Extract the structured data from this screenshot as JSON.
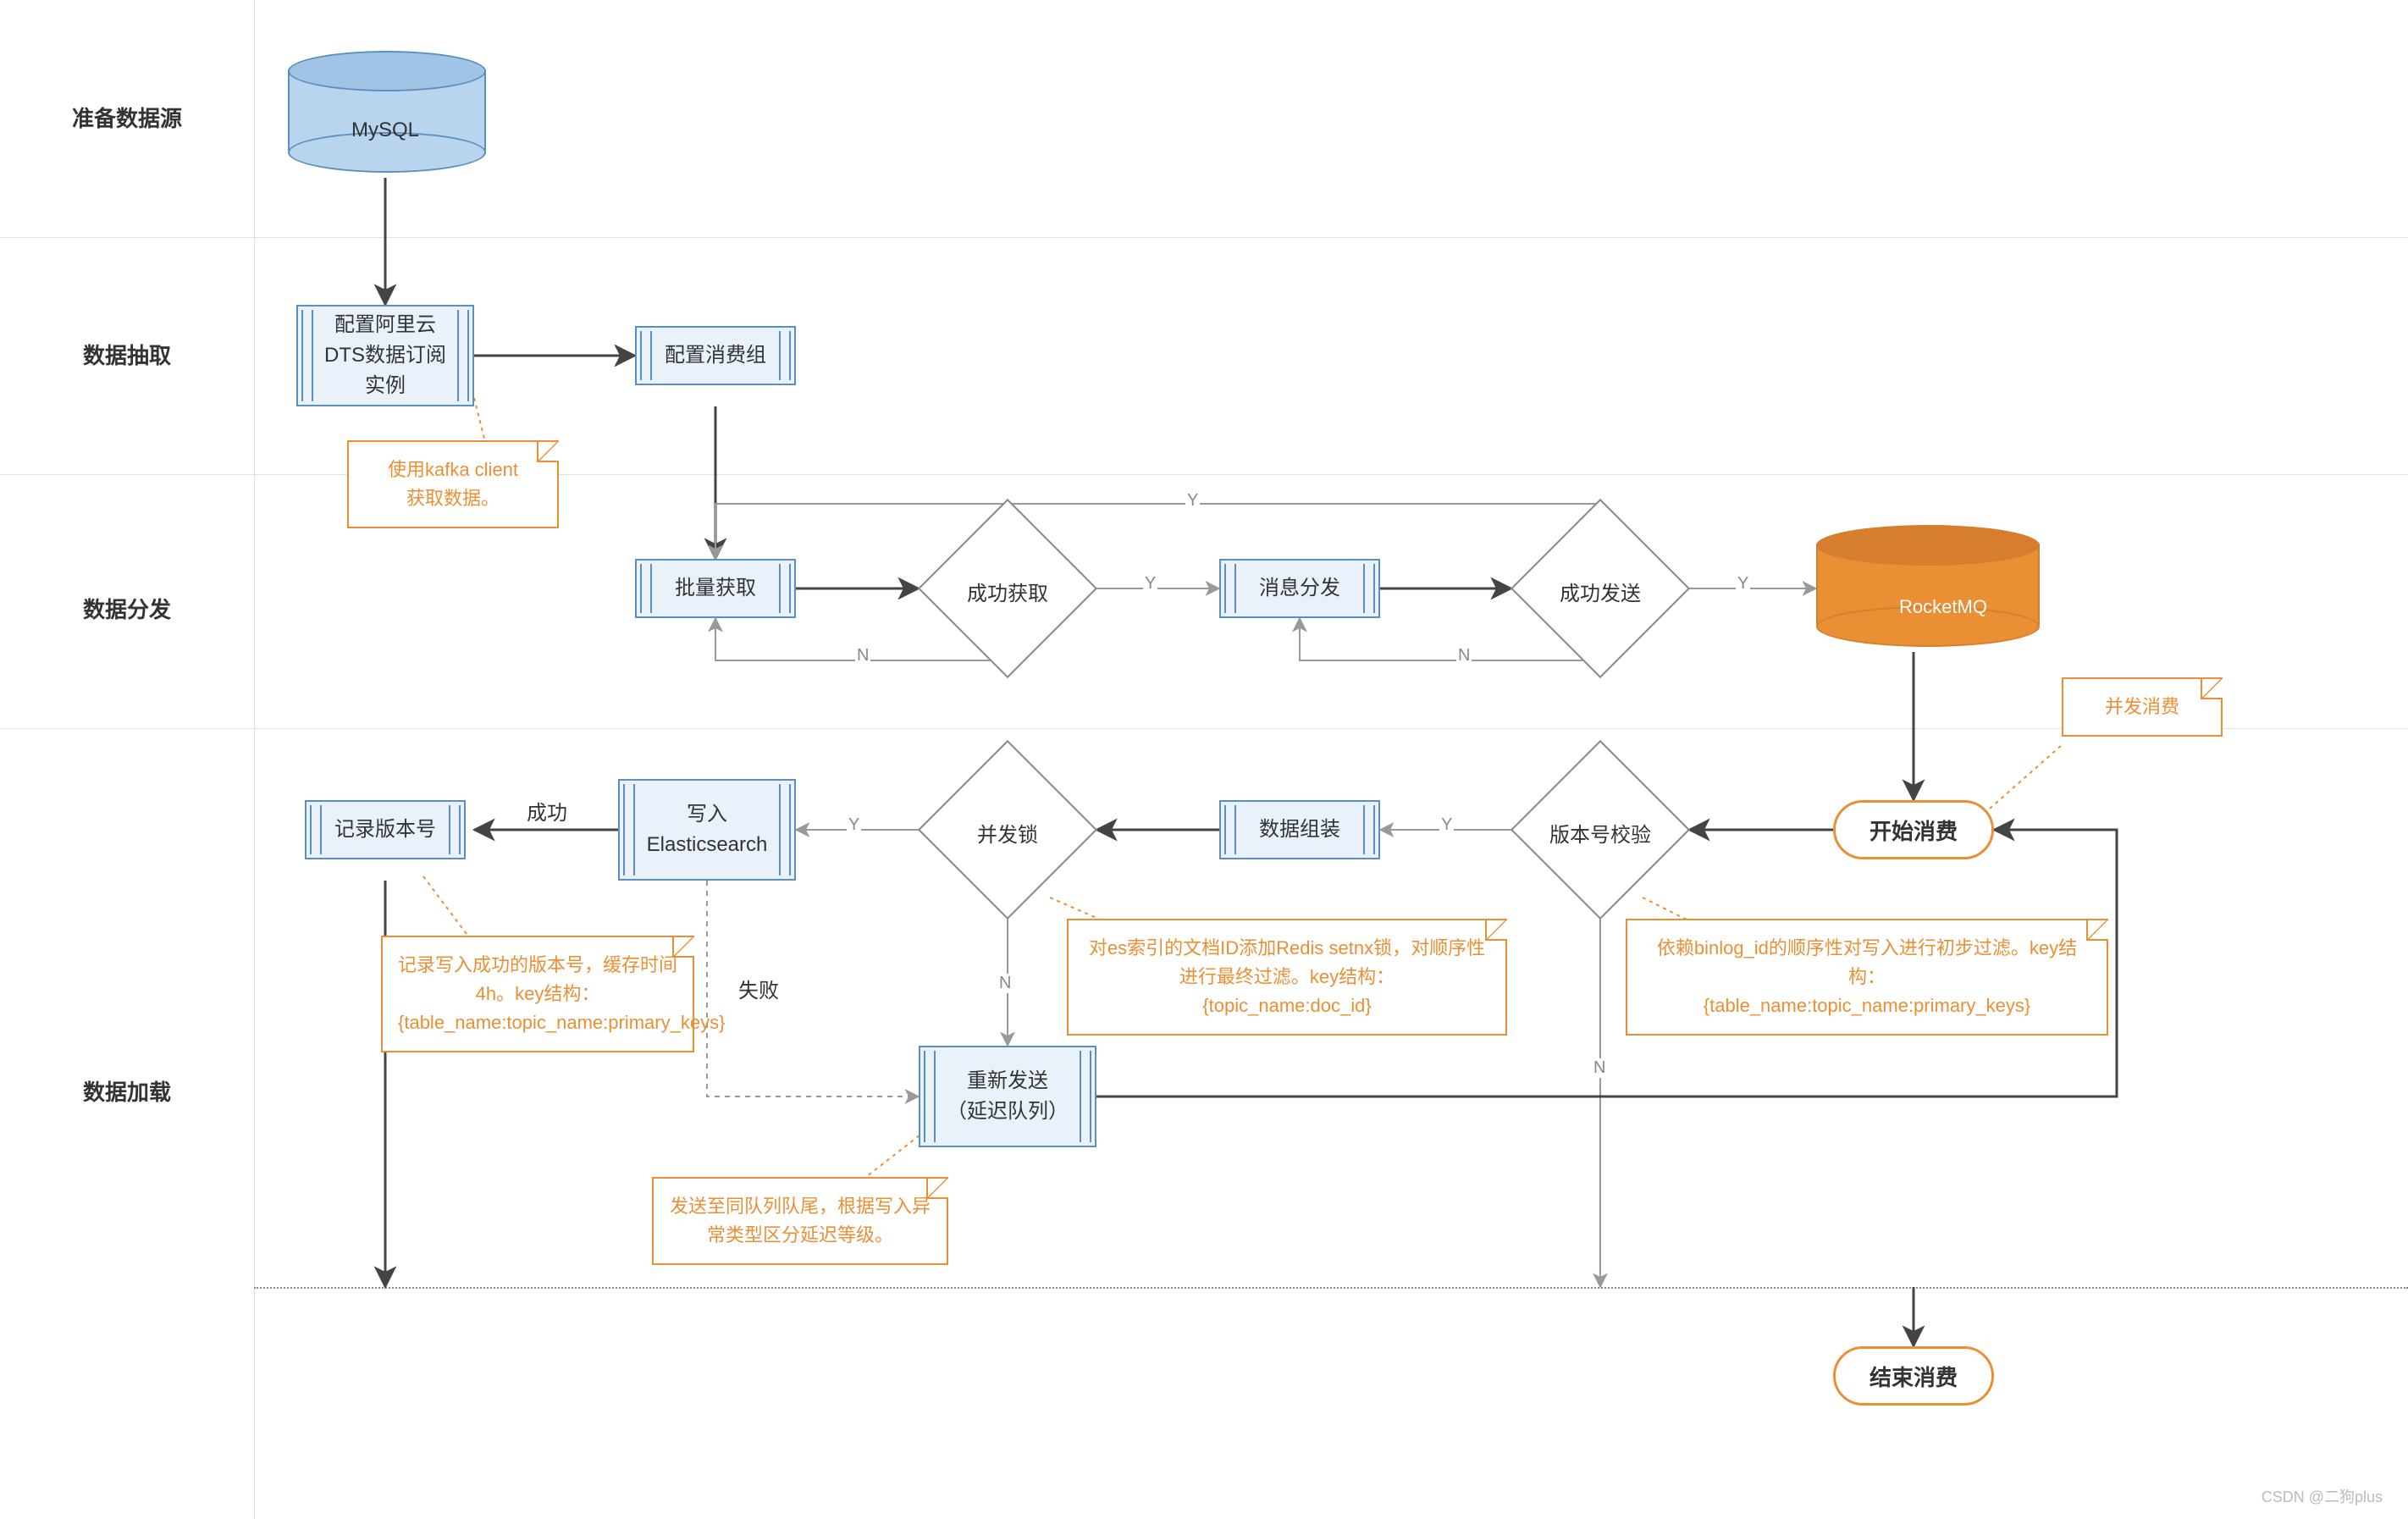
{
  "lanes": {
    "source": "准备数据源",
    "extract": "数据抽取",
    "dispatch": "数据分发",
    "load": "数据加载"
  },
  "nodes": {
    "mysql": "MySQL",
    "dts": "配置阿里云\nDTS数据订阅\n实例",
    "cg": "配置消费组",
    "batch": "批量获取",
    "gotOk": "成功获取",
    "msgDispatch": "消息分发",
    "sendOk": "成功发送",
    "rocket": "RocketMQ",
    "start": "开始消费",
    "verCheck": "版本号校验",
    "pack": "数据组装",
    "lock": "并发锁",
    "es": "写入\nElasticsearch",
    "recVer": "记录版本号",
    "resend": "重新发送\n（延迟队列）",
    "end": "结束消费"
  },
  "notes": {
    "kafka": "使用kafka client\n获取数据。",
    "concur": "并发消费",
    "verDep": "依赖binlog_id的顺序性对写入进行初步过滤。key结构：\n{table_name:topic_name:primary_keys}",
    "lockEs": "对es索引的文档ID添加Redis setnx锁，对顺序性进行最终过滤。key结构：\n{topic_name:doc_id}",
    "verRec": "记录写入成功的版本号，缓存时间4h。key结构：\n{table_name:topic_name:primary_keys}",
    "resendN": "发送至同队列队尾，根据写入异常类型区分延迟等级。"
  },
  "edgeLabels": {
    "Y": "Y",
    "N": "N",
    "success": "成功",
    "fail": "失败"
  },
  "watermark": "CSDN @二狗plus",
  "chart_data": {
    "type": "flowchart",
    "swimlanes": [
      {
        "id": "source",
        "label": "准备数据源"
      },
      {
        "id": "extract",
        "label": "数据抽取"
      },
      {
        "id": "dispatch",
        "label": "数据分发"
      },
      {
        "id": "load",
        "label": "数据加载"
      }
    ],
    "nodes": [
      {
        "id": "mysql",
        "type": "datastore",
        "lane": "source",
        "label": "MySQL"
      },
      {
        "id": "dts",
        "type": "process",
        "lane": "extract",
        "label": "配置阿里云DTS数据订阅实例"
      },
      {
        "id": "cg",
        "type": "process",
        "lane": "extract",
        "label": "配置消费组"
      },
      {
        "id": "batch",
        "type": "process",
        "lane": "dispatch",
        "label": "批量获取"
      },
      {
        "id": "gotOk",
        "type": "decision",
        "lane": "dispatch",
        "label": "成功获取"
      },
      {
        "id": "msgDispatch",
        "type": "process",
        "lane": "dispatch",
        "label": "消息分发"
      },
      {
        "id": "sendOk",
        "type": "decision",
        "lane": "dispatch",
        "label": "成功发送"
      },
      {
        "id": "rocket",
        "type": "datastore",
        "lane": "dispatch",
        "label": "RocketMQ"
      },
      {
        "id": "start",
        "type": "terminator",
        "lane": "load",
        "label": "开始消费"
      },
      {
        "id": "verCheck",
        "type": "decision",
        "lane": "load",
        "label": "版本号校验"
      },
      {
        "id": "pack",
        "type": "process",
        "lane": "load",
        "label": "数据组装"
      },
      {
        "id": "lock",
        "type": "decision",
        "lane": "load",
        "label": "并发锁"
      },
      {
        "id": "es",
        "type": "process",
        "lane": "load",
        "label": "写入Elasticsearch"
      },
      {
        "id": "recVer",
        "type": "process",
        "lane": "load",
        "label": "记录版本号"
      },
      {
        "id": "resend",
        "type": "process",
        "lane": "load",
        "label": "重新发送（延迟队列）"
      },
      {
        "id": "end",
        "type": "terminator",
        "lane": "load",
        "label": "结束消费"
      }
    ],
    "edges": [
      {
        "from": "mysql",
        "to": "dts"
      },
      {
        "from": "dts",
        "to": "cg"
      },
      {
        "from": "cg",
        "to": "batch"
      },
      {
        "from": "batch",
        "to": "gotOk"
      },
      {
        "from": "gotOk",
        "to": "msgDispatch",
        "label": "Y"
      },
      {
        "from": "gotOk",
        "to": "batch",
        "label": "N"
      },
      {
        "from": "msgDispatch",
        "to": "sendOk"
      },
      {
        "from": "sendOk",
        "to": "rocket",
        "label": "Y"
      },
      {
        "from": "sendOk",
        "to": "msgDispatch",
        "label": "N"
      },
      {
        "from": "sendOk",
        "to": "batch",
        "label": "Y"
      },
      {
        "from": "rocket",
        "to": "start"
      },
      {
        "from": "start",
        "to": "verCheck"
      },
      {
        "from": "verCheck",
        "to": "pack",
        "label": "Y"
      },
      {
        "from": "verCheck",
        "to": "end",
        "label": "N"
      },
      {
        "from": "pack",
        "to": "lock"
      },
      {
        "from": "lock",
        "to": "es",
        "label": "Y"
      },
      {
        "from": "lock",
        "to": "resend",
        "label": "N"
      },
      {
        "from": "es",
        "to": "recVer",
        "label": "成功"
      },
      {
        "from": "es",
        "to": "resend",
        "label": "失败"
      },
      {
        "from": "recVer",
        "to": "end"
      },
      {
        "from": "resend",
        "to": "start"
      }
    ],
    "annotations": [
      {
        "target": "dts",
        "text": "使用kafka client获取数据。"
      },
      {
        "target": "start",
        "text": "并发消费"
      },
      {
        "target": "verCheck",
        "text": "依赖binlog_id的顺序性对写入进行初步过滤。key结构：{table_name:topic_name:primary_keys}"
      },
      {
        "target": "lock",
        "text": "对es索引的文档ID添加Redis setnx锁，对顺序性进行最终过滤。key结构：{topic_name:doc_id}"
      },
      {
        "target": "recVer",
        "text": "记录写入成功的版本号，缓存时间4h。key结构：{table_name:topic_name:primary_keys}"
      },
      {
        "target": "resend",
        "text": "发送至同队列队尾，根据写入异常类型区分延迟等级。"
      }
    ]
  }
}
